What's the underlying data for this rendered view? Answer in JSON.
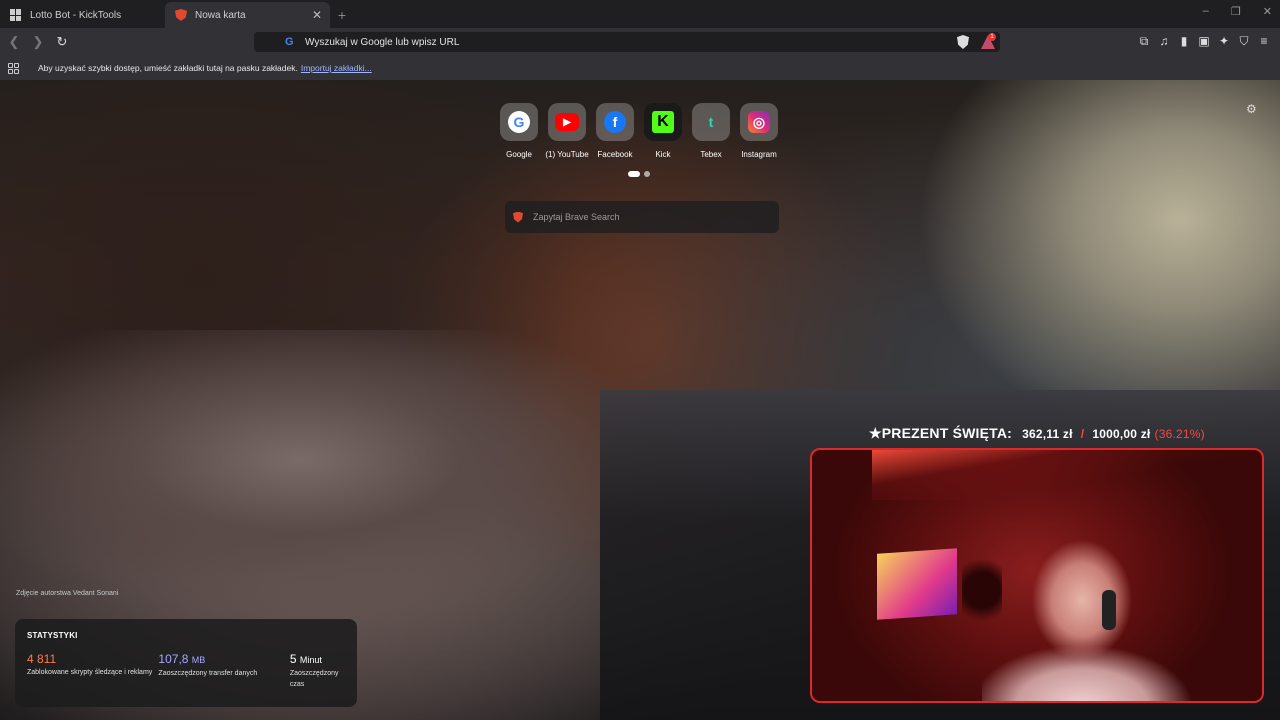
{
  "tabs": [
    {
      "title": "Lotto Bot - KickTools",
      "active": false
    },
    {
      "title": "Nowa karta",
      "active": true
    }
  ],
  "newtab_symbol": "+",
  "window_controls": [
    "–",
    "❐",
    "✕"
  ],
  "address_bar": {
    "placeholder": "Wyszukaj w Google lub wpisz URL"
  },
  "bookmarks_bar": {
    "message": "Aby uzyskać szybki dostęp, umieść zakładki tutaj na pasku zakładek.",
    "link": "Importuj zakładki..."
  },
  "rewards_badge": "1",
  "top_sites": [
    {
      "label": "Google",
      "icon": "google-icon",
      "glyph": "G",
      "color": "#4285f4",
      "bg": "#ffffff"
    },
    {
      "label": "(1) YouTube",
      "icon": "youtube-icon",
      "glyph": "▶",
      "color": "#ffffff",
      "bg": "#ff0000"
    },
    {
      "label": "Facebook",
      "icon": "facebook-icon",
      "glyph": "f",
      "color": "#ffffff",
      "bg": "#1877f2"
    },
    {
      "label": "Kick",
      "icon": "kick-icon",
      "glyph": "K",
      "color": "#000000",
      "bg": "#53fc18"
    },
    {
      "label": "Tebex",
      "icon": "tebex-icon",
      "glyph": "t",
      "color": "#2fd3b5",
      "bg": "transparent"
    },
    {
      "label": "Instagram",
      "icon": "instagram-icon",
      "glyph": "◎",
      "color": "#ffffff",
      "bg": "#d6249f"
    }
  ],
  "search": {
    "placeholder": "Zapytaj Brave Search"
  },
  "photo_credit": "Zdjęcie autorstwa Vedant Sonani",
  "stats": {
    "title": "STATYSTYKI",
    "items": [
      {
        "value": "4 811",
        "unit": "",
        "label": "Zablokowane skrypty śledzące i reklamy",
        "color": "#ff7a4d"
      },
      {
        "value": "107,8",
        "unit": "MB",
        "label": "Zaoszczędzony transfer danych",
        "color": "#a9a6ff"
      },
      {
        "value": "5",
        "unit": "Minut",
        "label": "Zaoszczędzony czas",
        "color": "#ffffff"
      }
    ]
  },
  "goal": {
    "title": "★PREZENT ŚWIĘTA:",
    "current": "362,11 zł",
    "separator": "/",
    "target": "1000,00 zł",
    "percent": "(36.21%)"
  },
  "colors": {
    "accent": "#fb542b",
    "goal_red": "#ff4545"
  }
}
